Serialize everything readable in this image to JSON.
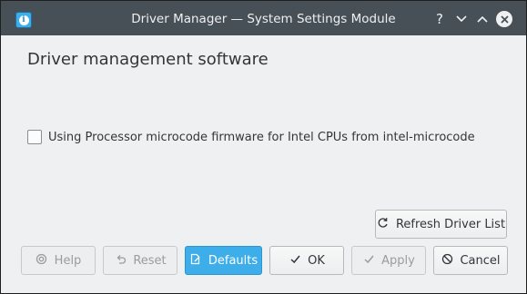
{
  "window": {
    "title": "Driver Manager — System Settings Module"
  },
  "titlebar_buttons": {
    "help_glyph": "?",
    "minimize_glyph": "⌄",
    "maximize_glyph": "⌃",
    "close_glyph": "✕"
  },
  "main": {
    "heading": "Driver management software",
    "driver_option": {
      "label": "Using Processor microcode firmware for Intel CPUs from intel-microcode",
      "checked": false
    }
  },
  "actions": {
    "refresh_label": "Refresh Driver List",
    "help_label": "Help",
    "reset_label": "Reset",
    "defaults_label": "Defaults",
    "ok_label": "OK",
    "apply_label": "Apply",
    "cancel_label": "Cancel"
  },
  "colors": {
    "titlebar": "#475057",
    "window_bg": "#eff0f1",
    "accent": "#3daee9"
  },
  "icons": {
    "app": "info-icon",
    "refresh": "refresh-icon",
    "help": "lifebuoy-icon",
    "reset": "undo-icon",
    "defaults": "document-edit-icon",
    "ok": "check-icon",
    "apply": "check-icon",
    "cancel": "cancel-icon"
  }
}
